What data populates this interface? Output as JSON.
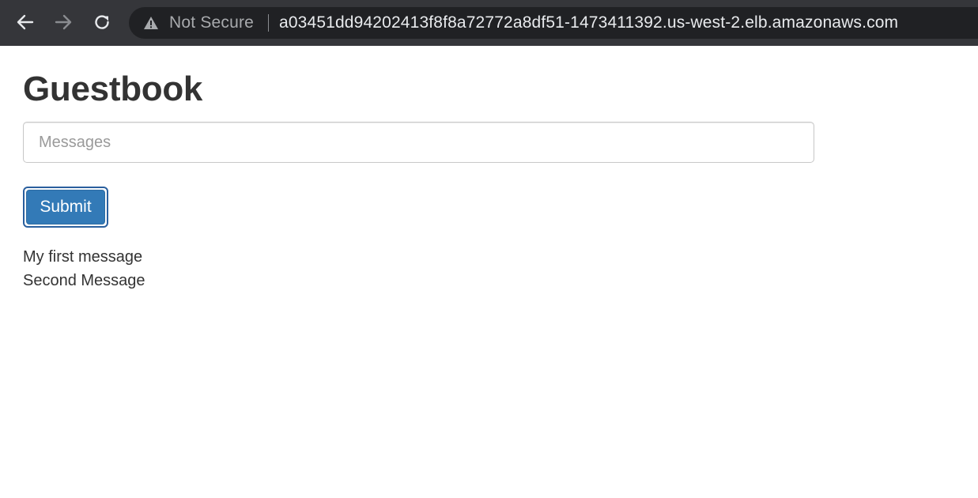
{
  "browser": {
    "security_label": "Not Secure",
    "url": "a03451dd94202413f8f8a72772a8df51-1473411392.us-west-2.elb.amazonaws.com",
    "icons": {
      "back": "arrow-left-icon",
      "forward": "arrow-right-icon",
      "reload": "reload-icon",
      "security": "warning-triangle-icon"
    }
  },
  "page": {
    "title": "Guestbook",
    "input": {
      "placeholder": "Messages",
      "value": ""
    },
    "submit_label": "Submit",
    "messages": [
      "My first message",
      "Second Message"
    ]
  },
  "colors": {
    "toolbar_bg": "#35363a",
    "omnibox_bg": "#202124",
    "button_primary": "#337ab7",
    "text_dark": "#333333"
  }
}
